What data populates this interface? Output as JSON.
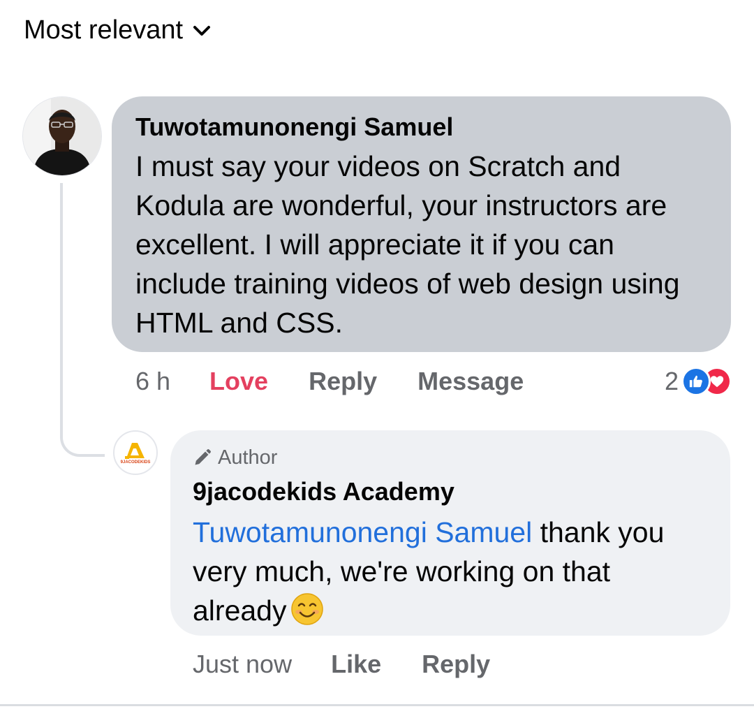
{
  "sort": {
    "label": "Most relevant"
  },
  "comment": {
    "author": "Tuwotamunonengi Samuel",
    "text": "I must say your videos on Scratch and Kodula are wonderful, your instructors are excellent. I will appreciate it if you can include training videos of web design using HTML and CSS.",
    "time": "6 h",
    "reaction_action": "Love",
    "reply_label": "Reply",
    "message_label": "Message",
    "reaction_count": "2",
    "reaction_icons": [
      "like-icon",
      "love-icon"
    ]
  },
  "reply": {
    "badge": "Author",
    "author": "9jacodekids Academy",
    "mention": "Tuwotamunonengi Samuel",
    "text": " thank you very much, we're working on that already",
    "emoji": "smiling-face-emoji",
    "time": "Just now",
    "like_label": "Like",
    "reply_label": "Reply",
    "avatar_logo_text": "9JACODEKIDS"
  },
  "colors": {
    "love": "#e4405f",
    "mention": "#216fdb",
    "bubble_main": "#caced4",
    "bubble_reply": "#eff1f4",
    "meta": "#65676b"
  }
}
